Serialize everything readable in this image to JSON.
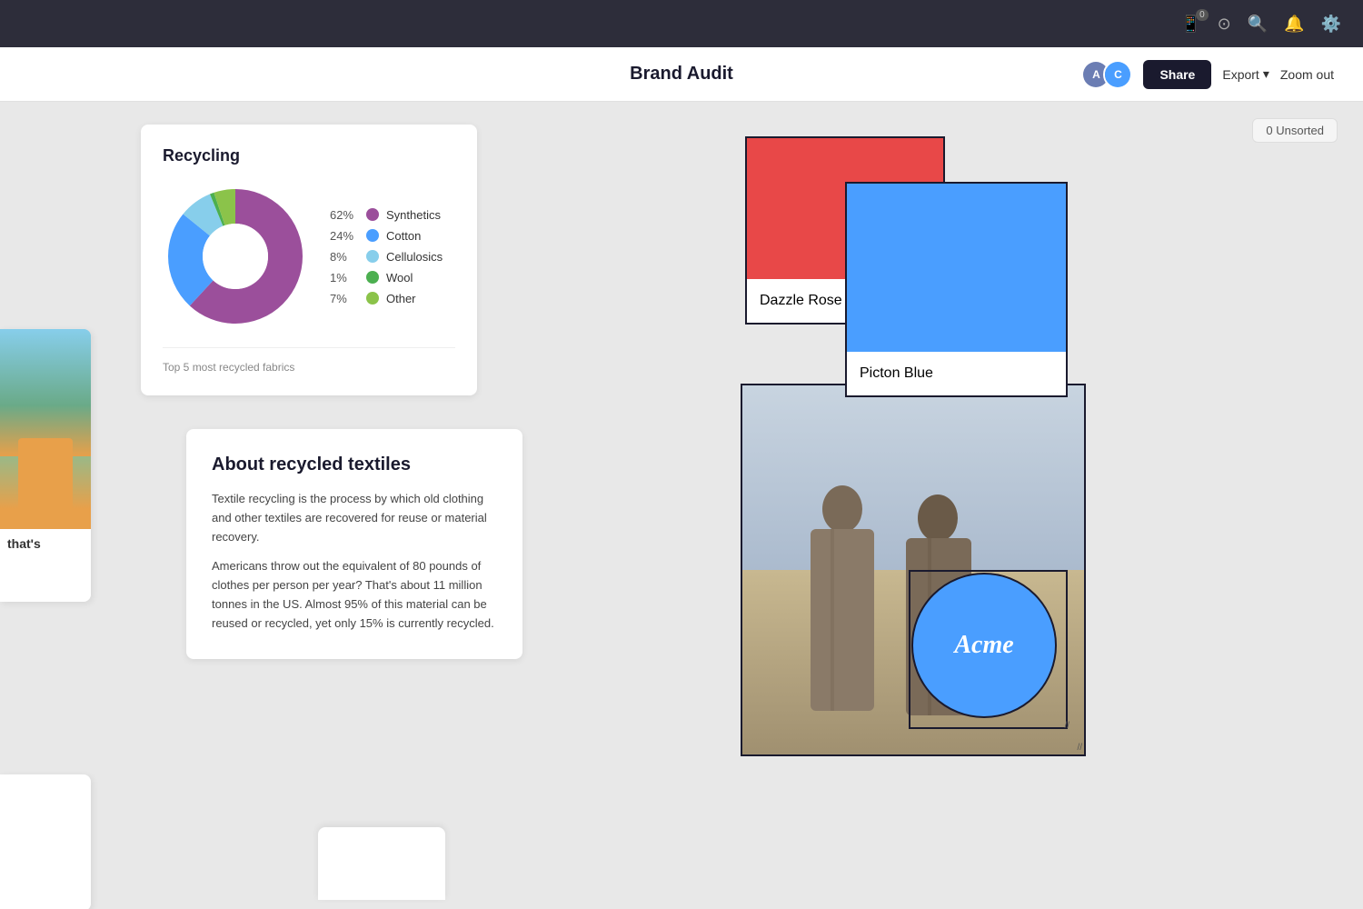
{
  "topbar": {
    "phone_badge": "0",
    "icons": [
      "phone",
      "help-circle",
      "search",
      "bell",
      "settings"
    ]
  },
  "header": {
    "title": "Brand Audit",
    "share_label": "Share",
    "export_label": "Export",
    "export_chevron": "▾",
    "zoom_label": "Zoom out",
    "avatars": [
      {
        "initials": "A",
        "color": "#6b7db3"
      },
      {
        "initials": "C",
        "color": "#4a9eff"
      }
    ]
  },
  "unsorted": {
    "label": "0 Unsorted"
  },
  "recycling_card": {
    "title": "Recycling",
    "footnote": "Top 5 most recycled fabrics",
    "chart": {
      "segments": [
        {
          "label": "Synthetics",
          "pct": 62,
          "color": "#9b4f9b",
          "degrees": 223
        },
        {
          "label": "Cotton",
          "pct": 24,
          "color": "#4a9eff",
          "degrees": 86
        },
        {
          "label": "Cellulosics",
          "pct": 8,
          "color": "#87ceeb",
          "degrees": 29
        },
        {
          "label": "Wool",
          "pct": 1,
          "color": "#4caf50",
          "degrees": 4
        },
        {
          "label": "Other",
          "pct": 7,
          "color": "#8bc34a",
          "degrees": 25
        }
      ]
    },
    "legend": [
      {
        "pct": "62%",
        "label": "Synthetics",
        "color": "#9b4f9b"
      },
      {
        "pct": "24%",
        "label": "Cotton",
        "color": "#4a9eff"
      },
      {
        "pct": "8%",
        "label": "Cellulosics",
        "color": "#87ceeb"
      },
      {
        "pct": "1%",
        "label": "Wool",
        "color": "#4caf50"
      },
      {
        "pct": "7%",
        "label": "Other",
        "color": "#8bc34a"
      }
    ]
  },
  "textiles_card": {
    "title": "About recycled textiles",
    "para1": "Textile recycling is the process by which old clothing and other textiles are recovered for reuse or material recovery.",
    "para2": "Americans throw out the equivalent of 80 pounds of clothes per person per year? That's about 11 million tonnes in the US. Almost 95% of this material can be reused or recycled, yet only 15% is currently recycled."
  },
  "color_swatches": {
    "rose_label": "Dazzle Rose",
    "rose_color": "#e84848",
    "blue_label": "Picton Blue",
    "blue_color": "#4a9eff"
  },
  "photo_card": {
    "acme_label": "Acme"
  },
  "left_partial": {
    "text": "that's"
  }
}
